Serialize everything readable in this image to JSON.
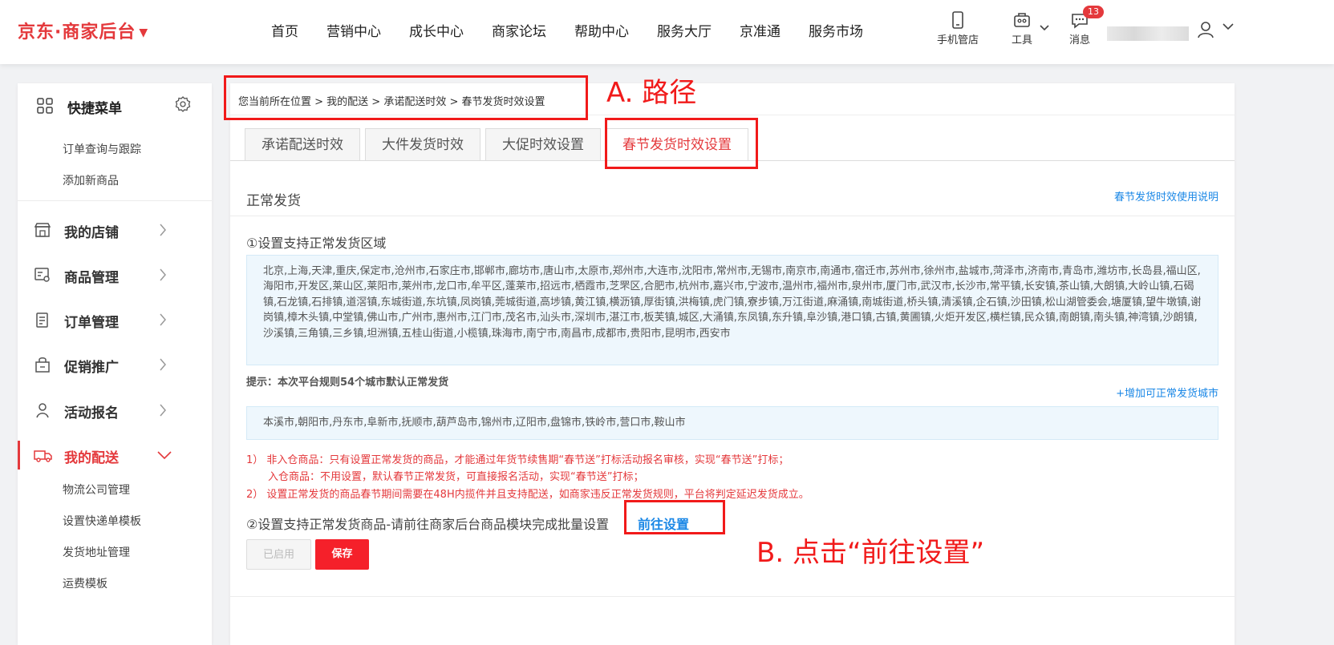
{
  "header": {
    "logo": "京东·商家后台",
    "nav": [
      "首页",
      "营销中心",
      "成长中心",
      "商家论坛",
      "帮助中心",
      "服务大厅",
      "京准通",
      "服务市场"
    ],
    "tools": {
      "mobile": "手机管店",
      "tools": "工具",
      "messages": "消息",
      "message_count": "13"
    }
  },
  "sidebar": {
    "quick_menu_title": "快捷菜单",
    "quick_items": [
      "订单查询与跟踪",
      "添加新商品"
    ],
    "menu": [
      "我的店铺",
      "商品管理",
      "订单管理",
      "促销推广",
      "活动报名",
      "我的配送"
    ],
    "sub_items": [
      "物流公司管理",
      "设置快递单模板",
      "发货地址管理",
      "运费模板"
    ]
  },
  "main": {
    "breadcrumb": "您当前所在位置 > 我的配送 > 承诺配送时效 > 春节发货时效设置",
    "tabs": [
      "承诺配送时效",
      "大件发货时效",
      "大促时效设置",
      "春节发货时效设置"
    ],
    "section_title": "正常发货",
    "help_link": "春节发货时效使用说明",
    "step1_title": "①设置支持正常发货区域",
    "regions": "北京,上海,天津,重庆,保定市,沧州市,石家庄市,邯郸市,廊坊市,唐山市,太原市,郑州市,大连市,沈阳市,常州市,无锡市,南京市,南通市,宿迁市,苏州市,徐州市,盐城市,菏泽市,济南市,青岛市,潍坊市,长岛县,福山区,海阳市,开发区,莱山区,莱阳市,莱州市,龙口市,牟平区,蓬莱市,招远市,栖霞市,芝罘区,合肥市,杭州市,嘉兴市,宁波市,温州市,福州市,泉州市,厦门市,武汉市,长沙市,常平镇,长安镇,茶山镇,大朗镇,大岭山镇,石碣镇,石龙镇,石排镇,道滘镇,东城街道,东坑镇,凤岗镇,莞城街道,高埗镇,黄江镇,横沥镇,厚街镇,洪梅镇,虎门镇,寮步镇,万江街道,麻涌镇,南城街道,桥头镇,清溪镇,企石镇,沙田镇,松山湖管委会,塘厦镇,望牛墩镇,谢岗镇,樟木头镇,中堂镇,佛山市,广州市,惠州市,江门市,茂名市,汕头市,深圳市,湛江市,板芙镇,城区,大涌镇,东凤镇,东升镇,阜沙镇,港口镇,古镇,黄圃镇,火炬开发区,横栏镇,民众镇,南朗镇,南头镇,神湾镇,沙朗镇,沙溪镇,三角镇,三乡镇,坦洲镇,五桂山街道,小榄镇,珠海市,南宁市,南昌市,成都市,贵阳市,昆明市,西安市",
    "tip": "提示：本次平台规则54个城市默认正常发货",
    "add_link": "+增加可正常发货城市",
    "extra_cities": "本溪市,朝阳市,丹东市,阜新市,抚顺市,葫芦岛市,锦州市,辽阳市,盘锦市,铁岭市,营口市,鞍山市",
    "rules": [
      "1）  非入仓商品：只有设置正常发货的商品，才能通过年货节续售期“春节送”打标活动报名审核，实现“春节送”打标；",
      "入仓商品：不用设置，默认春节正常发货，可直接报名活动，实现“春节送”打标；",
      "2）  设置正常发货的商品春节期间需要在48H内揽件并且支持配送，如商家违反正常发货规则，平台将判定延迟发货成立。"
    ],
    "step2_title": "②设置支持正常发货商品-请前往商家后台商品模块完成批量设置",
    "goto_link": "前往设置",
    "btn_enabled": "已启用",
    "btn_save": "保存"
  },
  "annotations": {
    "a": "A. 路径",
    "b": "B. 点击“前往设置”"
  },
  "colors": {
    "brand_red": "#e4393c",
    "link_blue": "#1a87e6",
    "annotation_red": "#f11a1a"
  }
}
